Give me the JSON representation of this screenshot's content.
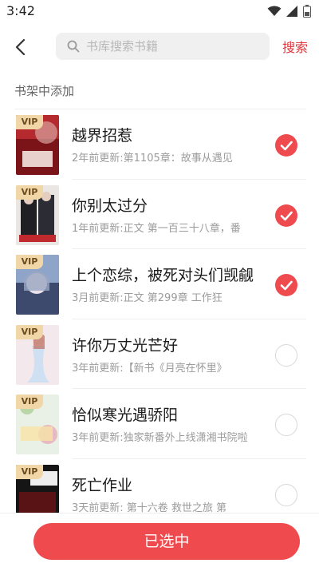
{
  "status_bar": {
    "time": "3:42",
    "icons": [
      "wifi-icon",
      "signal-icon",
      "battery-icon"
    ]
  },
  "header": {
    "back_icon": "chevron-left-icon",
    "search_placeholder": "书库搜索书籍",
    "search_value": "",
    "search_action": "搜索"
  },
  "section": {
    "title": "书架中添加"
  },
  "books": [
    {
      "title": "越界招惹",
      "meta": "2年前更新:第1105章：故事从遇见",
      "vip": "VIP",
      "selected": true
    },
    {
      "title": "你别太过分",
      "meta": "1年前更新:正文 第一百三十八章，番",
      "vip": "VIP",
      "selected": true
    },
    {
      "title": "上个恋综，被死对头们觊觎",
      "meta": "3月前更新:正文 第299章 工作狂",
      "vip": "VIP",
      "selected": true
    },
    {
      "title": "许你万丈光芒好",
      "meta": "3年前更新:【新书《月亮在怀里》",
      "vip": "VIP",
      "selected": false
    },
    {
      "title": "恰似寒光遇骄阳",
      "meta": "3年前更新:独家新番外上线潇湘书院啦",
      "vip": "VIP",
      "selected": false
    },
    {
      "title": "死亡作业",
      "meta": "3天前更新: 第十六卷 救世之旅 第",
      "vip": "VIP",
      "selected": false
    }
  ],
  "footer": {
    "button_label": "已选中"
  },
  "colors": {
    "accent": "#ef4b4f",
    "link": "#e0353b",
    "vip_bg": "#f1d7a8"
  }
}
